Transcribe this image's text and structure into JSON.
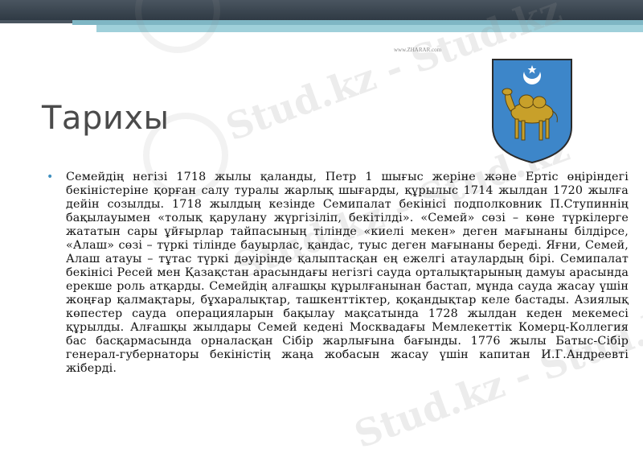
{
  "slide": {
    "title": "Тарихы",
    "site_caption": "www.ZHARAR.com",
    "watermark": "Stud.kz - Stud.kz",
    "paragraph": "Семейдің негізі 1718 жылы қаланды, Петр 1 шығыс жеріне және Ертіс өңіріндегі бекіністеріне қорған салу туралы жарлық шығарды, құрылыс 1714 жылдан 1720 жылға дейін созылды. 1718 жылдың кезінде Семипалат бекінісі подполковник П.Ступиннің бақылауымен «толық қарулану жүргізіліп, бекітілді». «Семей» сөзі – көне түркілерге жататын сары ұйғырлар тайпасының тілінде «киелі мекен» деген мағынаны білдірсе, «Алаш» сөзі – түркі тілінде бауырлас, қандас, туыс деген мағынаны береді. Яғни, Семей, Алаш атауы – тұтас түркі дәуірінде қалыптасқан ең ежелгі атаулардың бірі. Семипалат бекінісі Ресей мен Қазақстан арасындағы негізгі сауда орталықтарының дамуы арасында ерекше роль атқарды. Семейдің алғашқы құрылғанынан бастап, мұнда сауда жасау үшін жоңғар қалмақтары, бұхаралықтар, ташкенттіктер, қоқандықтар келе бастады. Азиялық көпестер сауда операцияларын бақылау мақсатында 1728 жылдан кеден мекемесі құрылды. Алғашқы жылдары Семей кедені Москвадағы Мемлекеттік Комерц-Коллегия бас басқармасында орналасқан Сібір жарлығына бағынды. 1776 жылы Батыс-Сібір генерал-губернаторы бекіністің жаңа жобасын жасау үшін капитан И.Г.Андреевті жіберді."
  },
  "colors": {
    "shield_blue": "#3d86c9",
    "camel_gold": "#c8a02a",
    "bullet": "#3f8fbf",
    "top_bar": "#36414b",
    "stripe": "#9fd0da"
  }
}
